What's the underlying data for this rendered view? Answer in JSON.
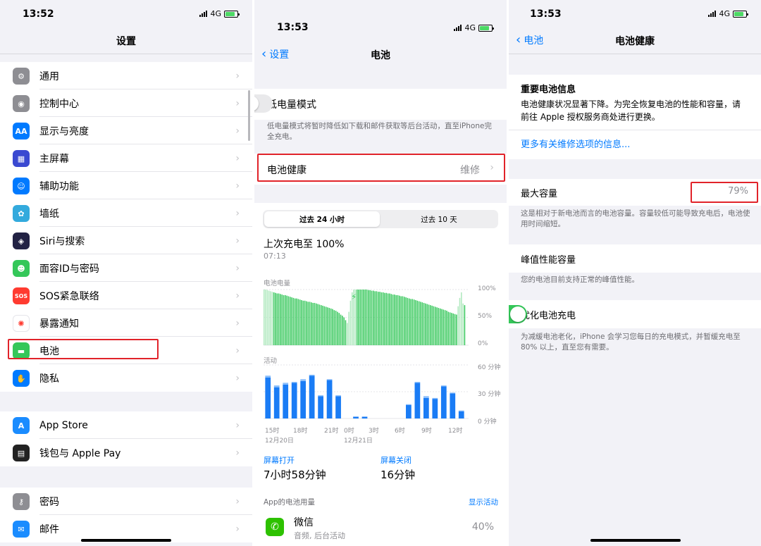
{
  "screen1": {
    "status": {
      "time": "13:52",
      "network": "4G"
    },
    "title": "设置",
    "groups": [
      [
        {
          "label": "通用",
          "icon": "gear-icon",
          "color": "#8e8e93",
          "glyph": "⚙"
        },
        {
          "label": "控制中心",
          "icon": "switches-icon",
          "color": "#8e8e93",
          "glyph": "◉"
        },
        {
          "label": "显示与亮度",
          "icon": "display-icon",
          "color": "#007aff",
          "glyph": "AA"
        },
        {
          "label": "主屏幕",
          "icon": "home-screen-icon",
          "color": "#3a49d1",
          "glyph": "▦"
        },
        {
          "label": "辅助功能",
          "icon": "accessibility-icon",
          "color": "#007aff",
          "glyph": "☺"
        },
        {
          "label": "墙纸",
          "icon": "wallpaper-icon",
          "color": "#33aadd",
          "glyph": "✿"
        },
        {
          "label": "Siri与搜索",
          "icon": "siri-icon",
          "color": "#222244",
          "glyph": "◈"
        },
        {
          "label": "面容ID与密码",
          "icon": "face-id-icon",
          "color": "#34c759",
          "glyph": "☻"
        },
        {
          "label": "SOS紧急联络",
          "icon": "sos-icon",
          "color": "#ff3b30",
          "glyph": "SOS"
        },
        {
          "label": "暴露通知",
          "icon": "exposure-icon",
          "color": "#ffffff",
          "glyph": "✺"
        },
        {
          "label": "电池",
          "icon": "battery-icon",
          "color": "#34c759",
          "glyph": "▬"
        },
        {
          "label": "隐私",
          "icon": "hand-icon",
          "color": "#007aff",
          "glyph": "✋"
        }
      ],
      [
        {
          "label": "App Store",
          "icon": "app-store-icon",
          "color": "#1a8cff",
          "glyph": "A"
        },
        {
          "label": "钱包与 Apple Pay",
          "icon": "wallet-icon",
          "color": "#222222",
          "glyph": "▤"
        }
      ],
      [
        {
          "label": "密码",
          "icon": "key-icon",
          "color": "#8e8e93",
          "glyph": "⚷"
        },
        {
          "label": "邮件",
          "icon": "mail-icon",
          "color": "#1a8cff",
          "glyph": "✉"
        }
      ]
    ]
  },
  "screen2": {
    "status": {
      "time": "13:53",
      "network": "4G"
    },
    "back_label": "设置",
    "title": "电池",
    "low_power": {
      "label": "低电量模式",
      "on": false,
      "note": "低电量模式将暂时降低如下载和邮件获取等后台活动，直至iPhone完全充电。"
    },
    "health": {
      "label": "电池健康",
      "value": "维修"
    },
    "segments": [
      "过去 24 小时",
      "过去 10 天"
    ],
    "last_charge": {
      "label": "上次充电至 100%",
      "time": "07:13"
    },
    "level_chart_title": "电池电量",
    "level_ticks": [
      "100%",
      "50%",
      "0%"
    ],
    "activity_chart_title": "活动",
    "activity_ticks": [
      "60 分钟",
      "30 分钟",
      "0 分钟"
    ],
    "x_ticks": [
      "15时",
      "18时",
      "21时",
      "0时",
      "3时",
      "6时",
      "9时",
      "12时"
    ],
    "dates": [
      "12月20日",
      "12月21日"
    ],
    "screen_on": {
      "label": "屏幕打开",
      "value": "7小时58分钟"
    },
    "screen_off": {
      "label": "屏幕关闭",
      "value": "16分钟"
    },
    "usage_header": "App的电池用量",
    "show_activity": "显示活动",
    "app": {
      "name": "微信",
      "detail": "音频, 后台活动",
      "pct": "40%"
    }
  },
  "chart_data": [
    {
      "type": "bar",
      "title": "电池电量",
      "ylim": [
        0,
        100
      ],
      "y_ticks": [
        "100%",
        "50%",
        "0%"
      ],
      "x_ticks": [
        "15时",
        "18时",
        "21时",
        "0时",
        "3时",
        "6时",
        "9时",
        "12时"
      ],
      "values": [
        100,
        100,
        99,
        98,
        97,
        96,
        95,
        94,
        93,
        93,
        92,
        91,
        90,
        90,
        89,
        88,
        87,
        86,
        85,
        84,
        84,
        83,
        82,
        81,
        80,
        80,
        79,
        78,
        78,
        77,
        76,
        76,
        75,
        74,
        73,
        72,
        71,
        70,
        69,
        68,
        67,
        66,
        65,
        63,
        62,
        60,
        58,
        55,
        53,
        50,
        45,
        40,
        60,
        80,
        95,
        100,
        100,
        100,
        100,
        100,
        100,
        100,
        100,
        100,
        99,
        99,
        98,
        98,
        97,
        97,
        96,
        96,
        95,
        95,
        94,
        94,
        93,
        93,
        92,
        91,
        91,
        90,
        90,
        89,
        88,
        88,
        87,
        86,
        85,
        84,
        83,
        83,
        82,
        81,
        80,
        79,
        78,
        77,
        76,
        75,
        74,
        73,
        72,
        71,
        70,
        69,
        68,
        67,
        66,
        65,
        64,
        63,
        62,
        60,
        59,
        58,
        57,
        56,
        55,
        70,
        85,
        95,
        75,
        72
      ],
      "charging_ranges": [
        [
          0,
          5
        ],
        [
          51,
          56
        ],
        [
          119,
          122
        ]
      ],
      "colors": {
        "level": "#34c759",
        "charging": "#aee8bd"
      }
    },
    {
      "type": "bar",
      "title": "活动",
      "ylim": [
        0,
        60
      ],
      "y_ticks": [
        "60 分钟",
        "30 分钟",
        "0 分钟"
      ],
      "x_ticks": [
        "15时",
        "18时",
        "21时",
        "0时",
        "3时",
        "6时",
        "9时",
        "12时"
      ],
      "series": [
        {
          "values": [
            46,
            35,
            38,
            40,
            42,
            48,
            25,
            43,
            25,
            0,
            2,
            2,
            0,
            0,
            0,
            0,
            15,
            40,
            23,
            22,
            36,
            28,
            8
          ]
        },
        {
          "values": [
            2,
            2,
            2,
            1,
            2,
            1,
            1,
            1,
            1,
            0,
            0,
            0,
            0,
            0,
            0,
            0,
            1,
            1,
            2,
            1,
            1,
            1,
            1
          ]
        }
      ],
      "colors": {
        "screen_on": "#1a7cf5",
        "screen_off": "#88bdfb"
      }
    }
  ],
  "screen3": {
    "status": {
      "time": "13:53",
      "network": "4G"
    },
    "back_label": "电池",
    "title": "电池健康",
    "important_title": "重要电池信息",
    "important_text": "电池健康状况显著下降。为完全恢复电池的性能和容量，请前往 Apple 授权服务商处进行更换。",
    "service_link": "更多有关维修选项的信息...",
    "max_capacity": {
      "label": "最大容量",
      "value": "79%",
      "note": "这是相对于新电池而言的电池容量。容量较低可能导致充电后，电池使用时间缩短。"
    },
    "peak": {
      "label": "峰值性能容量",
      "note": "您的电池目前支持正常的峰值性能。"
    },
    "optimize": {
      "label": "优化电池充电",
      "on": true,
      "note": "为减缓电池老化，iPhone 会学习您每日的充电模式，并暂缓充电至 80% 以上，直至您有需要。"
    }
  },
  "accent_colors": {
    "blue": "#007aff",
    "green": "#34c759",
    "red_box": "#e1232a"
  }
}
